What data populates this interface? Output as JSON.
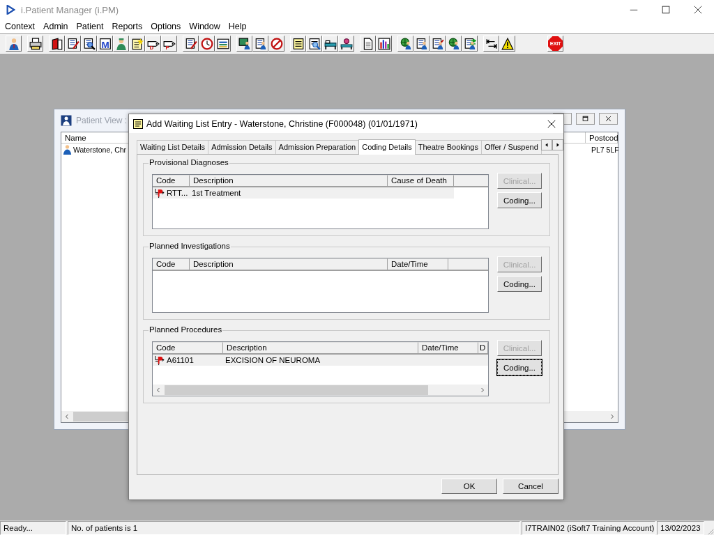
{
  "app": {
    "title": "i.Patient Manager (i.PM)",
    "active": false
  },
  "menu": [
    "Context",
    "Admin",
    "Patient",
    "Reports",
    "Options",
    "Window",
    "Help"
  ],
  "toolbar": [
    [
      {
        "kind": "person"
      }
    ],
    [
      {
        "kind": "printer"
      }
    ],
    [
      {
        "kind": "book"
      },
      {
        "kind": "form-pen"
      },
      {
        "kind": "search-form"
      },
      {
        "kind": "letter",
        "label": "M"
      },
      {
        "kind": "surgeon"
      },
      {
        "kind": "note-star"
      },
      {
        "kind": "tag",
        "label": "D"
      },
      {
        "kind": "tag",
        "label": "P"
      }
    ],
    [
      {
        "kind": "form-pen"
      },
      {
        "kind": "clock"
      },
      {
        "kind": "screen"
      }
    ],
    [
      {
        "kind": "monitor-person"
      },
      {
        "kind": "form-person"
      },
      {
        "kind": "no-entry"
      }
    ],
    [
      {
        "kind": "note"
      },
      {
        "kind": "search-note"
      },
      {
        "kind": "bed"
      },
      {
        "kind": "bed-person"
      }
    ],
    [
      {
        "kind": "document"
      },
      {
        "kind": "chart"
      }
    ],
    [
      {
        "kind": "globe-person"
      },
      {
        "kind": "form-person"
      },
      {
        "kind": "pen-person"
      },
      {
        "kind": "globe-person"
      },
      {
        "kind": "arrows-person"
      }
    ],
    [
      {
        "kind": "arrows"
      },
      {
        "kind": "warning"
      }
    ],
    [
      {
        "kind": "exit",
        "label": "EXIT"
      }
    ]
  ],
  "patient_view": {
    "title": "Patient View :",
    "columns": [
      "Name",
      "Postcod"
    ],
    "rows": [
      {
        "name": "Waterstone, Chr",
        "postcode": "PL7 5LF"
      }
    ]
  },
  "dialog": {
    "title": "Add Waiting List Entry - Waterstone, Christine (F000048) (01/01/1971)",
    "tabs": [
      {
        "label": "Waiting List Details",
        "selected": false
      },
      {
        "label": "Admission Details",
        "selected": false
      },
      {
        "label": "Admission Preparation",
        "selected": false
      },
      {
        "label": "Coding Details",
        "selected": true
      },
      {
        "label": "Theatre Bookings",
        "selected": false
      },
      {
        "label": "Offer / Suspend",
        "selected": false
      }
    ],
    "sections": [
      {
        "title": "Provisional Diagnoses",
        "columns": [
          "Code",
          "Description",
          "Cause of Death"
        ],
        "rows": [
          {
            "code": "RTT...",
            "description": "1st Treatment",
            "selected": true
          }
        ],
        "buttons": [
          {
            "label": "Clinical...",
            "disabled": true,
            "focused": false
          },
          {
            "label": "Coding...",
            "disabled": false,
            "focused": false
          }
        ]
      },
      {
        "title": "Planned Investigations",
        "columns": [
          "Code",
          "Description",
          "Date/Time"
        ],
        "buttons": [
          {
            "label": "Clinical...",
            "disabled": true,
            "focused": false
          },
          {
            "label": "Coding...",
            "disabled": false,
            "focused": false
          }
        ]
      },
      {
        "title": "Planned Procedures",
        "columns": [
          "Code",
          "Description",
          "Date/Time",
          "D"
        ],
        "rows": [
          {
            "code": "A61101",
            "description": "EXCISION OF NEUROMA",
            "selected": true
          }
        ],
        "h_scroll": true,
        "buttons": [
          {
            "label": "Clinical...",
            "disabled": true,
            "focused": false
          },
          {
            "label": "Coding...",
            "disabled": false,
            "focused": true
          }
        ]
      }
    ],
    "buttons": [
      "OK",
      "Cancel"
    ]
  },
  "status_bar": [
    "Ready...",
    "No. of patients is 1",
    "I7TRAIN02 (iSoft7 Training Account)",
    "13/02/2023"
  ]
}
